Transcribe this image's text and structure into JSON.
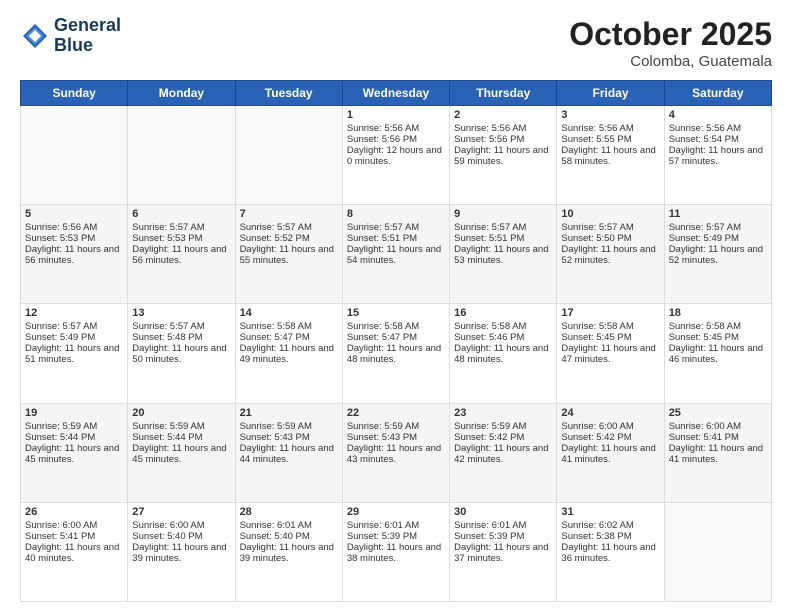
{
  "header": {
    "logo_line1": "General",
    "logo_line2": "Blue",
    "month": "October 2025",
    "location": "Colomba, Guatemala"
  },
  "weekdays": [
    "Sunday",
    "Monday",
    "Tuesday",
    "Wednesday",
    "Thursday",
    "Friday",
    "Saturday"
  ],
  "weeks": [
    [
      {
        "day": "",
        "sunrise": "",
        "sunset": "",
        "daylight": ""
      },
      {
        "day": "",
        "sunrise": "",
        "sunset": "",
        "daylight": ""
      },
      {
        "day": "",
        "sunrise": "",
        "sunset": "",
        "daylight": ""
      },
      {
        "day": "1",
        "sunrise": "Sunrise: 5:56 AM",
        "sunset": "Sunset: 5:56 PM",
        "daylight": "Daylight: 12 hours and 0 minutes."
      },
      {
        "day": "2",
        "sunrise": "Sunrise: 5:56 AM",
        "sunset": "Sunset: 5:56 PM",
        "daylight": "Daylight: 11 hours and 59 minutes."
      },
      {
        "day": "3",
        "sunrise": "Sunrise: 5:56 AM",
        "sunset": "Sunset: 5:55 PM",
        "daylight": "Daylight: 11 hours and 58 minutes."
      },
      {
        "day": "4",
        "sunrise": "Sunrise: 5:56 AM",
        "sunset": "Sunset: 5:54 PM",
        "daylight": "Daylight: 11 hours and 57 minutes."
      }
    ],
    [
      {
        "day": "5",
        "sunrise": "Sunrise: 5:56 AM",
        "sunset": "Sunset: 5:53 PM",
        "daylight": "Daylight: 11 hours and 56 minutes."
      },
      {
        "day": "6",
        "sunrise": "Sunrise: 5:57 AM",
        "sunset": "Sunset: 5:53 PM",
        "daylight": "Daylight: 11 hours and 56 minutes."
      },
      {
        "day": "7",
        "sunrise": "Sunrise: 5:57 AM",
        "sunset": "Sunset: 5:52 PM",
        "daylight": "Daylight: 11 hours and 55 minutes."
      },
      {
        "day": "8",
        "sunrise": "Sunrise: 5:57 AM",
        "sunset": "Sunset: 5:51 PM",
        "daylight": "Daylight: 11 hours and 54 minutes."
      },
      {
        "day": "9",
        "sunrise": "Sunrise: 5:57 AM",
        "sunset": "Sunset: 5:51 PM",
        "daylight": "Daylight: 11 hours and 53 minutes."
      },
      {
        "day": "10",
        "sunrise": "Sunrise: 5:57 AM",
        "sunset": "Sunset: 5:50 PM",
        "daylight": "Daylight: 11 hours and 52 minutes."
      },
      {
        "day": "11",
        "sunrise": "Sunrise: 5:57 AM",
        "sunset": "Sunset: 5:49 PM",
        "daylight": "Daylight: 11 hours and 52 minutes."
      }
    ],
    [
      {
        "day": "12",
        "sunrise": "Sunrise: 5:57 AM",
        "sunset": "Sunset: 5:49 PM",
        "daylight": "Daylight: 11 hours and 51 minutes."
      },
      {
        "day": "13",
        "sunrise": "Sunrise: 5:57 AM",
        "sunset": "Sunset: 5:48 PM",
        "daylight": "Daylight: 11 hours and 50 minutes."
      },
      {
        "day": "14",
        "sunrise": "Sunrise: 5:58 AM",
        "sunset": "Sunset: 5:47 PM",
        "daylight": "Daylight: 11 hours and 49 minutes."
      },
      {
        "day": "15",
        "sunrise": "Sunrise: 5:58 AM",
        "sunset": "Sunset: 5:47 PM",
        "daylight": "Daylight: 11 hours and 48 minutes."
      },
      {
        "day": "16",
        "sunrise": "Sunrise: 5:58 AM",
        "sunset": "Sunset: 5:46 PM",
        "daylight": "Daylight: 11 hours and 48 minutes."
      },
      {
        "day": "17",
        "sunrise": "Sunrise: 5:58 AM",
        "sunset": "Sunset: 5:45 PM",
        "daylight": "Daylight: 11 hours and 47 minutes."
      },
      {
        "day": "18",
        "sunrise": "Sunrise: 5:58 AM",
        "sunset": "Sunset: 5:45 PM",
        "daylight": "Daylight: 11 hours and 46 minutes."
      }
    ],
    [
      {
        "day": "19",
        "sunrise": "Sunrise: 5:59 AM",
        "sunset": "Sunset: 5:44 PM",
        "daylight": "Daylight: 11 hours and 45 minutes."
      },
      {
        "day": "20",
        "sunrise": "Sunrise: 5:59 AM",
        "sunset": "Sunset: 5:44 PM",
        "daylight": "Daylight: 11 hours and 45 minutes."
      },
      {
        "day": "21",
        "sunrise": "Sunrise: 5:59 AM",
        "sunset": "Sunset: 5:43 PM",
        "daylight": "Daylight: 11 hours and 44 minutes."
      },
      {
        "day": "22",
        "sunrise": "Sunrise: 5:59 AM",
        "sunset": "Sunset: 5:43 PM",
        "daylight": "Daylight: 11 hours and 43 minutes."
      },
      {
        "day": "23",
        "sunrise": "Sunrise: 5:59 AM",
        "sunset": "Sunset: 5:42 PM",
        "daylight": "Daylight: 11 hours and 42 minutes."
      },
      {
        "day": "24",
        "sunrise": "Sunrise: 6:00 AM",
        "sunset": "Sunset: 5:42 PM",
        "daylight": "Daylight: 11 hours and 41 minutes."
      },
      {
        "day": "25",
        "sunrise": "Sunrise: 6:00 AM",
        "sunset": "Sunset: 5:41 PM",
        "daylight": "Daylight: 11 hours and 41 minutes."
      }
    ],
    [
      {
        "day": "26",
        "sunrise": "Sunrise: 6:00 AM",
        "sunset": "Sunset: 5:41 PM",
        "daylight": "Daylight: 11 hours and 40 minutes."
      },
      {
        "day": "27",
        "sunrise": "Sunrise: 6:00 AM",
        "sunset": "Sunset: 5:40 PM",
        "daylight": "Daylight: 11 hours and 39 minutes."
      },
      {
        "day": "28",
        "sunrise": "Sunrise: 6:01 AM",
        "sunset": "Sunset: 5:40 PM",
        "daylight": "Daylight: 11 hours and 39 minutes."
      },
      {
        "day": "29",
        "sunrise": "Sunrise: 6:01 AM",
        "sunset": "Sunset: 5:39 PM",
        "daylight": "Daylight: 11 hours and 38 minutes."
      },
      {
        "day": "30",
        "sunrise": "Sunrise: 6:01 AM",
        "sunset": "Sunset: 5:39 PM",
        "daylight": "Daylight: 11 hours and 37 minutes."
      },
      {
        "day": "31",
        "sunrise": "Sunrise: 6:02 AM",
        "sunset": "Sunset: 5:38 PM",
        "daylight": "Daylight: 11 hours and 36 minutes."
      },
      {
        "day": "",
        "sunrise": "",
        "sunset": "",
        "daylight": ""
      }
    ]
  ]
}
